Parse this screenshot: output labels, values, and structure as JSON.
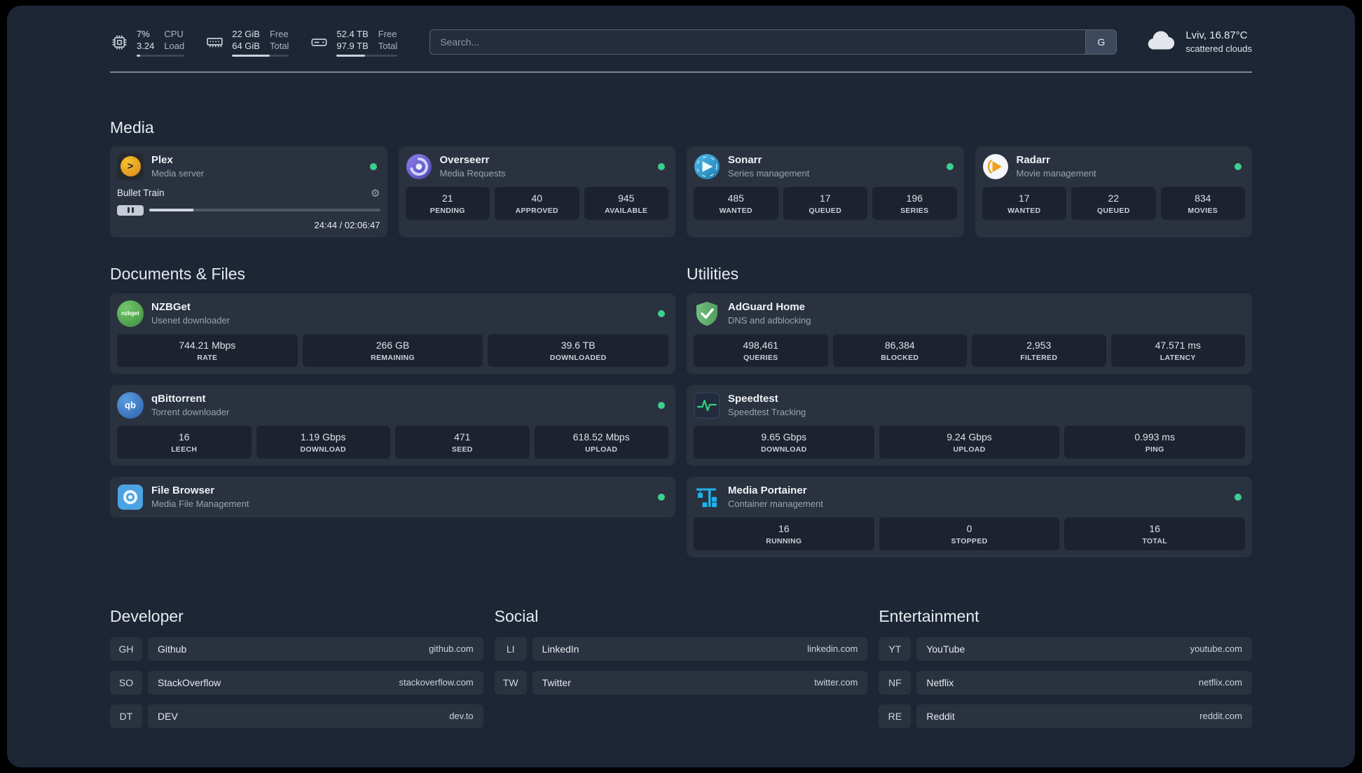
{
  "topbar": {
    "cpu": {
      "icon": "cpu-chip-icon",
      "value_top": "7%",
      "value_bottom": "3.24",
      "label_top": "CPU",
      "label_bottom": "Load",
      "usage_percent": 7
    },
    "memory": {
      "icon": "memory-icon",
      "value_top": "22 GiB",
      "value_bottom": "64 GiB",
      "label_top": "Free",
      "label_bottom": "Total",
      "usage_percent": 66
    },
    "disk": {
      "icon": "disk-icon",
      "value_top": "52.4 TB",
      "value_bottom": "97.9 TB",
      "label_top": "Free",
      "label_bottom": "Total",
      "usage_percent": 47
    },
    "search": {
      "placeholder": "Search...",
      "provider_button": "G"
    },
    "weather": {
      "icon": "cloud-icon",
      "location": "Lviv, 16.87°C",
      "condition": "scattered clouds"
    }
  },
  "media": {
    "title": "Media",
    "cards": [
      {
        "name": "Plex",
        "subtitle": "Media server",
        "icon": "plex-icon",
        "status": "online",
        "player": {
          "track": "Bullet Train",
          "time": "24:44 / 02:06:47",
          "progress_percent": 19
        }
      },
      {
        "name": "Overseerr",
        "subtitle": "Media Requests",
        "icon": "overseerr-icon",
        "status": "online",
        "stats": [
          {
            "value": "21",
            "label": "PENDING"
          },
          {
            "value": "40",
            "label": "APPROVED"
          },
          {
            "value": "945",
            "label": "AVAILABLE"
          }
        ]
      },
      {
        "name": "Sonarr",
        "subtitle": "Series management",
        "icon": "sonarr-icon",
        "status": "online",
        "stats": [
          {
            "value": "485",
            "label": "WANTED"
          },
          {
            "value": "17",
            "label": "QUEUED"
          },
          {
            "value": "196",
            "label": "SERIES"
          }
        ]
      },
      {
        "name": "Radarr",
        "subtitle": "Movie management",
        "icon": "radarr-icon",
        "status": "online",
        "stats": [
          {
            "value": "17",
            "label": "WANTED"
          },
          {
            "value": "22",
            "label": "QUEUED"
          },
          {
            "value": "834",
            "label": "MOVIES"
          }
        ]
      }
    ]
  },
  "documents": {
    "title": "Documents & Files",
    "cards": [
      {
        "name": "NZBGet",
        "subtitle": "Usenet downloader",
        "icon": "nzbget-icon",
        "status": "online",
        "stats": [
          {
            "value": "744.21 Mbps",
            "label": "RATE"
          },
          {
            "value": "266 GB",
            "label": "REMAINING"
          },
          {
            "value": "39.6 TB",
            "label": "DOWNLOADED"
          }
        ]
      },
      {
        "name": "qBittorrent",
        "subtitle": "Torrent downloader",
        "icon": "qbittorrent-icon",
        "status": "online",
        "stats": [
          {
            "value": "16",
            "label": "LEECH"
          },
          {
            "value": "1.19 Gbps",
            "label": "DOWNLOAD"
          },
          {
            "value": "471",
            "label": "SEED"
          },
          {
            "value": "618.52 Mbps",
            "label": "UPLOAD"
          }
        ]
      },
      {
        "name": "File Browser",
        "subtitle": "Media File Management",
        "icon": "filebrowser-icon",
        "status": "online",
        "stats": []
      }
    ]
  },
  "utilities": {
    "title": "Utilities",
    "cards": [
      {
        "name": "AdGuard Home",
        "subtitle": "DNS and adblocking",
        "icon": "adguard-icon",
        "stats": [
          {
            "value": "498,461",
            "label": "QUERIES"
          },
          {
            "value": "86,384",
            "label": "BLOCKED"
          },
          {
            "value": "2,953",
            "label": "FILTERED"
          },
          {
            "value": "47.571 ms",
            "label": "LATENCY"
          }
        ]
      },
      {
        "name": "Speedtest",
        "subtitle": "Speedtest Tracking",
        "icon": "speedtest-icon",
        "stats": [
          {
            "value": "9.65 Gbps",
            "label": "DOWNLOAD"
          },
          {
            "value": "9.24 Gbps",
            "label": "UPLOAD"
          },
          {
            "value": "0.993 ms",
            "label": "PING"
          }
        ]
      },
      {
        "name": "Media Portainer",
        "subtitle": "Container management",
        "icon": "portainer-icon",
        "status": "online",
        "stats": [
          {
            "value": "16",
            "label": "RUNNING"
          },
          {
            "value": "0",
            "label": "STOPPED"
          },
          {
            "value": "16",
            "label": "TOTAL"
          }
        ]
      }
    ]
  },
  "bookmarks": {
    "groups": [
      {
        "title": "Developer",
        "items": [
          {
            "abbr": "GH",
            "name": "Github",
            "domain": "github.com"
          },
          {
            "abbr": "SO",
            "name": "StackOverflow",
            "domain": "stackoverflow.com"
          },
          {
            "abbr": "DT",
            "name": "DEV",
            "domain": "dev.to"
          }
        ]
      },
      {
        "title": "Social",
        "items": [
          {
            "abbr": "LI",
            "name": "LinkedIn",
            "domain": "linkedin.com"
          },
          {
            "abbr": "TW",
            "name": "Twitter",
            "domain": "twitter.com"
          }
        ]
      },
      {
        "title": "Entertainment",
        "items": [
          {
            "abbr": "YT",
            "name": "YouTube",
            "domain": "youtube.com"
          },
          {
            "abbr": "NF",
            "name": "Netflix",
            "domain": "netflix.com"
          },
          {
            "abbr": "RE",
            "name": "Reddit",
            "domain": "reddit.com"
          }
        ]
      }
    ]
  },
  "misc": {
    "nzbget_icon_text": "nzbget",
    "qb_icon_text": "qb",
    "plex_icon_glyph": ">"
  },
  "colors": {
    "status_online": "#3ecf8e",
    "accent_green": "#2fd180",
    "background": "#1d2635"
  }
}
